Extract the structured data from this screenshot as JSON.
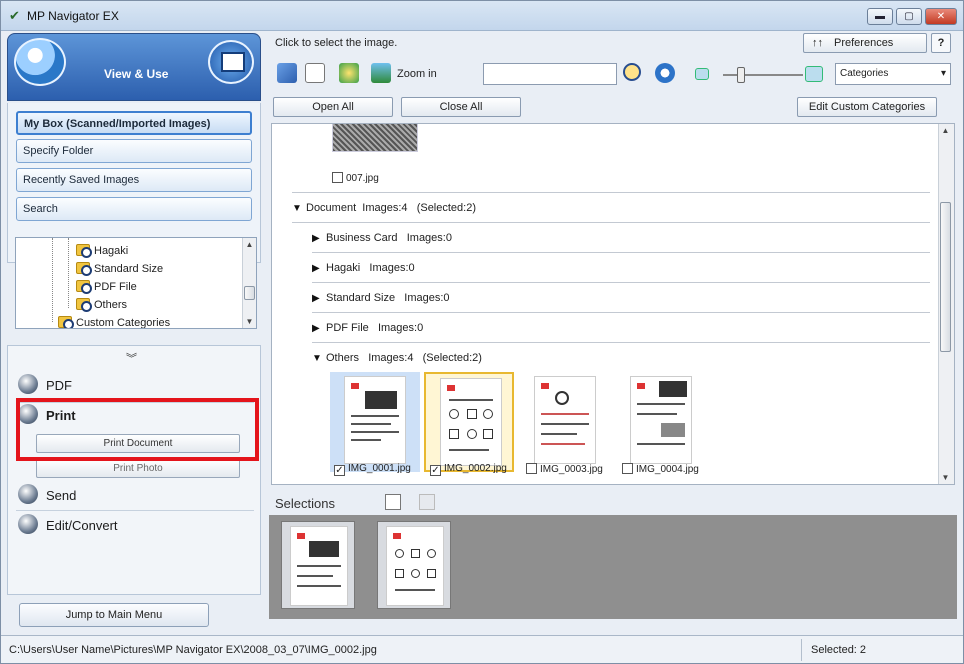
{
  "window": {
    "title": "MP Navigator EX"
  },
  "left": {
    "mode_label": "View & Use",
    "nav": [
      {
        "label": "My Box (Scanned/Imported Images)",
        "active": true
      },
      {
        "label": "Specify Folder"
      },
      {
        "label": "Recently Saved Images"
      },
      {
        "label": "Search"
      }
    ],
    "tree": [
      "Hagaki",
      "Standard Size",
      "PDF File",
      "Others",
      "Custom Categories"
    ],
    "actions": {
      "pdf": "PDF",
      "print": "Print",
      "print_document": "Print Document",
      "print_photo": "Print Photo",
      "send": "Send",
      "edit": "Edit/Convert"
    },
    "jump_button": "Jump to Main Menu"
  },
  "right": {
    "hint": "Click to select the image.",
    "preferences": "Preferences",
    "help": "?",
    "zoom_in": "Zoom in",
    "search_value": "",
    "category_select": "Categories",
    "open_all": "Open All",
    "close_all": "Close All",
    "edit_custom": "Edit Custom Categories",
    "top_file": "007.jpg",
    "categories": [
      {
        "name": "Document",
        "images": "Images:4",
        "selected": "(Selected:2)",
        "expanded": true,
        "level": 0
      },
      {
        "name": "Business Card",
        "images": "Images:0",
        "selected": "",
        "expanded": false,
        "level": 1
      },
      {
        "name": "Hagaki",
        "images": "Images:0",
        "selected": "",
        "expanded": false,
        "level": 1
      },
      {
        "name": "Standard Size",
        "images": "Images:0",
        "selected": "",
        "expanded": false,
        "level": 1
      },
      {
        "name": "PDF File",
        "images": "Images:0",
        "selected": "",
        "expanded": false,
        "level": 1
      },
      {
        "name": "Others",
        "images": "Images:4",
        "selected": "(Selected:2)",
        "expanded": true,
        "level": 1
      }
    ],
    "thumbnails": [
      {
        "file": "IMG_0001.jpg",
        "checked": true
      },
      {
        "file": "IMG_0002.jpg",
        "checked": true
      },
      {
        "file": "IMG_0003.jpg",
        "checked": false
      },
      {
        "file": "IMG_0004.jpg",
        "checked": false
      }
    ],
    "selections_label": "Selections"
  },
  "status": {
    "path": "C:\\Users\\User Name\\Pictures\\MP Navigator EX\\2008_03_07\\IMG_0002.jpg",
    "selected": "Selected: 2"
  },
  "colors": {
    "highlight": "#e4141b",
    "accent": "#2c5fae"
  }
}
